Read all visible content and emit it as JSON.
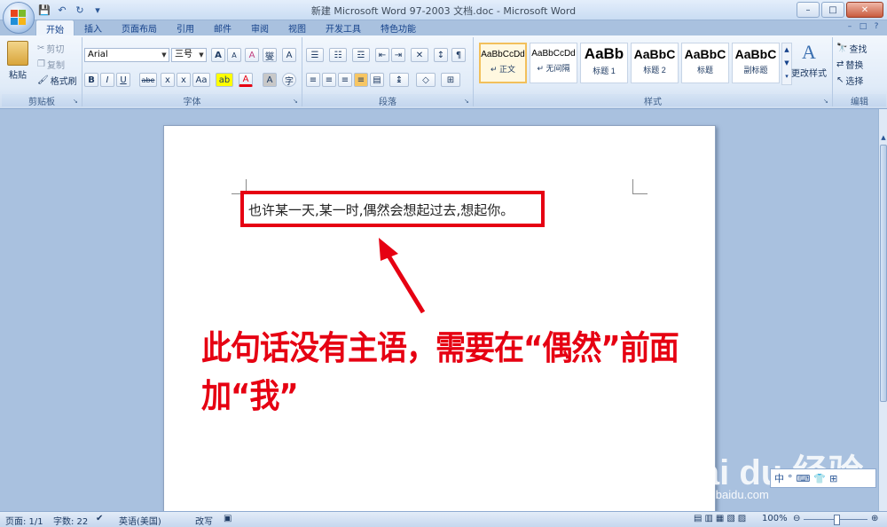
{
  "window": {
    "title": "新建 Microsoft Word 97-2003 文档.doc - Microsoft Word",
    "controls": {
      "minimize": "–",
      "maximize": "□",
      "close": "✕"
    }
  },
  "quick_access": [
    "save-icon",
    "undo-icon",
    "redo-icon",
    "customize-icon"
  ],
  "tabs": [
    {
      "label": "开始",
      "active": true
    },
    {
      "label": "插入"
    },
    {
      "label": "页面布局"
    },
    {
      "label": "引用"
    },
    {
      "label": "邮件"
    },
    {
      "label": "审阅"
    },
    {
      "label": "视图"
    },
    {
      "label": "开发工具"
    },
    {
      "label": "特色功能"
    }
  ],
  "ribbon": {
    "clipboard": {
      "label": "剪贴板",
      "paste": "粘贴",
      "cut": "剪切",
      "copy": "复制",
      "format_painter": "格式刷"
    },
    "font": {
      "label": "字体",
      "font_name": "Arial",
      "font_size": "三号",
      "grow": "A",
      "shrink": "A",
      "clear": "A",
      "phonetic": "燮",
      "border_char": "A",
      "bold": "B",
      "italic": "I",
      "underline": "U",
      "strike": "abe",
      "subscript": "x",
      "superscript": "x",
      "change_case": "Aa",
      "highlight": "ab",
      "font_color": "A",
      "char_shading": "A",
      "enclose": "字"
    },
    "paragraph": {
      "label": "段落"
    },
    "styles": {
      "label": "样式",
      "items": [
        {
          "sample": "AaBbCcDd",
          "name": "↵ 正文",
          "active": true
        },
        {
          "sample": "AaBbCcDd",
          "name": "↵ 无间隔"
        },
        {
          "sample": "AaBb",
          "name": "标题 1"
        },
        {
          "sample": "AaBbC",
          "name": "标题 2"
        },
        {
          "sample": "AaBbC",
          "name": "标题"
        },
        {
          "sample": "AaBbC",
          "name": "副标题"
        }
      ],
      "change_styles": "更改样式"
    },
    "editing": {
      "label": "编辑",
      "find": "查找",
      "replace": "替换",
      "select": "选择"
    }
  },
  "document": {
    "text": "也许某一天,某一时,偶然会想起过去,想起你。",
    "annotation": "此句话没有主语，需要在“偶然”前面加“我”"
  },
  "watermark": {
    "brand": "Bai du 经验",
    "url": "jingyan.baidu.com"
  },
  "ime_bar": [
    "中",
    "°",
    "⌨",
    "👕",
    "⊞"
  ],
  "status_bar": {
    "page": "页面: 1/1",
    "words": "字数: 22",
    "language": "英语(美国)",
    "mode": "改写",
    "zoom": "100%"
  },
  "colors": {
    "annotation_red": "#e60012",
    "ribbon_bg": "#e0ebf8",
    "workspace": "#a9c1df"
  }
}
